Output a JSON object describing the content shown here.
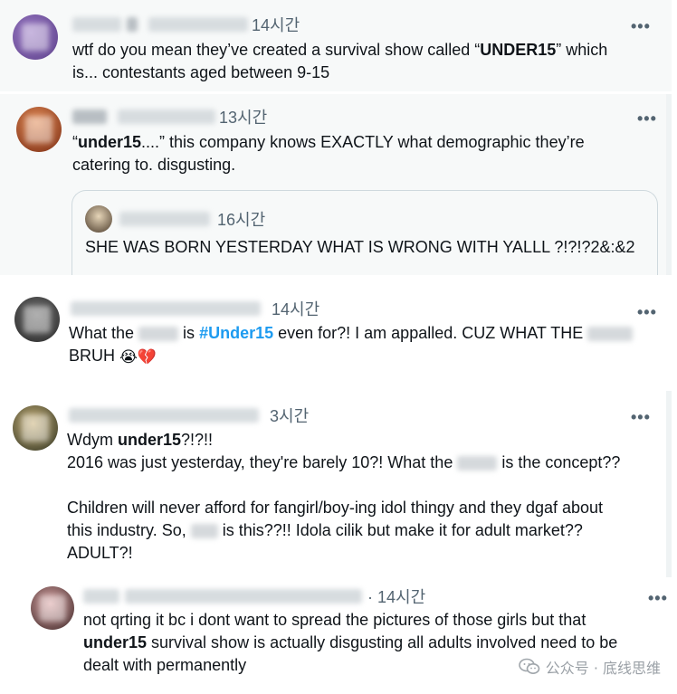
{
  "tweets": [
    {
      "time": "14시간",
      "more": "•••",
      "lines": [
        "wtf do you mean they’ve created a survival show called “",
        "UNDER15",
        "” which",
        "is... contestants aged between 9-15"
      ]
    },
    {
      "time": "13시간",
      "more": "•••",
      "lines": [
        "“",
        "under15",
        "....” this company knows EXACTLY what demographic they’re",
        "catering to. disgusting."
      ],
      "quote": {
        "time": "16시간",
        "text": "SHE WAS BORN YESTERDAY WHAT IS WRONG WITH YALLL ?!?!?2&:&2"
      }
    },
    {
      "time": "14시간",
      "more": "•••",
      "lines": [
        "What the ",
        " is ",
        "#Under15",
        " even for?! I am appalled. CUZ WHAT THE ",
        "BRUH "
      ],
      "emoji": [
        "😭",
        "💔"
      ]
    },
    {
      "time": "3시간",
      "more": "•••",
      "lines": [
        "Wdym ",
        "under15",
        "?!?!!",
        "2016 was just yesterday, they're barely 10?! What the ",
        " is the concept??",
        "Children will never afford for fangirl/boy-ing idol thingy and they dgaf about",
        "this industry. So, ",
        " is this??!! Idola cilik but make it for adult market??",
        "ADULT?!"
      ]
    },
    {
      "time": "14시간",
      "more": "•••",
      "lines": [
        "not qrting it bc i dont want to spread the pictures of those girls but that",
        "under15",
        " survival show is actually disgusting all adults involved need to be",
        "dealt with permanently"
      ]
    }
  ],
  "watermark": {
    "label": "公众号 · 底线思维"
  },
  "colors": {
    "text": "#0f1419",
    "meta": "#536471",
    "hashtag": "#1d9bf0",
    "panel_bg": "#f7f9f9",
    "border": "#cfd9de"
  }
}
